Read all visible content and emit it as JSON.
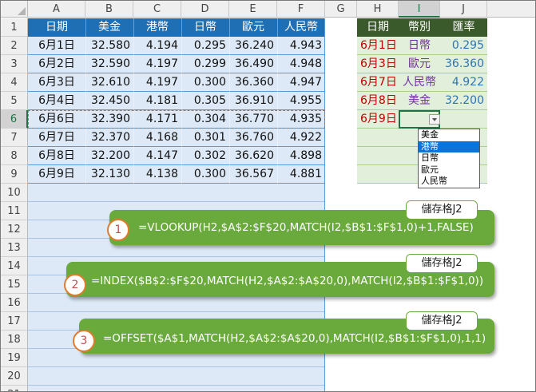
{
  "columns": [
    "A",
    "B",
    "C",
    "D",
    "E",
    "F",
    "G",
    "H",
    "I",
    "J"
  ],
  "rows": [
    "1",
    "2",
    "3",
    "4",
    "5",
    "6",
    "7",
    "8",
    "9",
    "10",
    "11",
    "12",
    "13",
    "14",
    "15",
    "16",
    "17",
    "18",
    "19",
    "20",
    "21"
  ],
  "table_left": {
    "headers": [
      "日期",
      "美金",
      "港幣",
      "日幣",
      "歐元",
      "人民幣"
    ],
    "rows": [
      [
        "6月1日",
        "32.580",
        "4.194",
        "0.295",
        "36.240",
        "4.943"
      ],
      [
        "6月2日",
        "32.590",
        "4.197",
        "0.299",
        "36.490",
        "4.948"
      ],
      [
        "6月3日",
        "32.610",
        "4.197",
        "0.300",
        "36.360",
        "4.947"
      ],
      [
        "6月4日",
        "32.450",
        "4.181",
        "0.305",
        "36.910",
        "4.955"
      ],
      [
        "6月6日",
        "32.390",
        "4.171",
        "0.304",
        "36.770",
        "4.935"
      ],
      [
        "6月7日",
        "32.370",
        "4.168",
        "0.301",
        "36.760",
        "4.922"
      ],
      [
        "6月8日",
        "32.200",
        "4.147",
        "0.302",
        "36.620",
        "4.898"
      ],
      [
        "6月9日",
        "32.130",
        "4.138",
        "0.300",
        "36.567",
        "4.881"
      ]
    ]
  },
  "table_right": {
    "headers": [
      "日期",
      "幣別",
      "匯率"
    ],
    "rows": [
      [
        "6月1日",
        "日幣",
        "0.295"
      ],
      [
        "6月3日",
        "歐元",
        "36.360"
      ],
      [
        "6月7日",
        "人民幣",
        "4.922"
      ],
      [
        "6月8日",
        "美金",
        "32.200"
      ],
      [
        "6月9日",
        "",
        ""
      ]
    ]
  },
  "dropdown": {
    "options": [
      "美金",
      "港幣",
      "日幣",
      "歐元",
      "人民幣"
    ],
    "highlighted": "港幣"
  },
  "callouts": [
    {
      "number": "1",
      "tag": "儲存格J2",
      "formula": "=VLOOKUP(H2,$A$2:$F$20,MATCH(I2,$B$1:$F$1,0)+1,FALSE)"
    },
    {
      "number": "2",
      "tag": "儲存格J2",
      "formula": "=INDEX($B$2:$F$20,MATCH(H2,$A$2:$A$20,0),MATCH(I2,$B$1:$F$1,0))"
    },
    {
      "number": "3",
      "tag": "儲存格J2",
      "formula": "=OFFSET($A$1,MATCH(H2,$A$2:$A$20,0),MATCH(I2,$B$1:$F$1,0),1,1)"
    }
  ],
  "colors": {
    "left_header_bg": "#1f6fb5",
    "left_fill": "#dde9f6",
    "right_header_bg": "#3b5a2c",
    "right_fill": "#e2efda",
    "date_red": "#c00000",
    "currency_purple": "#7030a0",
    "rate_blue": "#2e75b6",
    "callout_green": "#6aaa3c",
    "number_orange": "#e07b2e"
  }
}
